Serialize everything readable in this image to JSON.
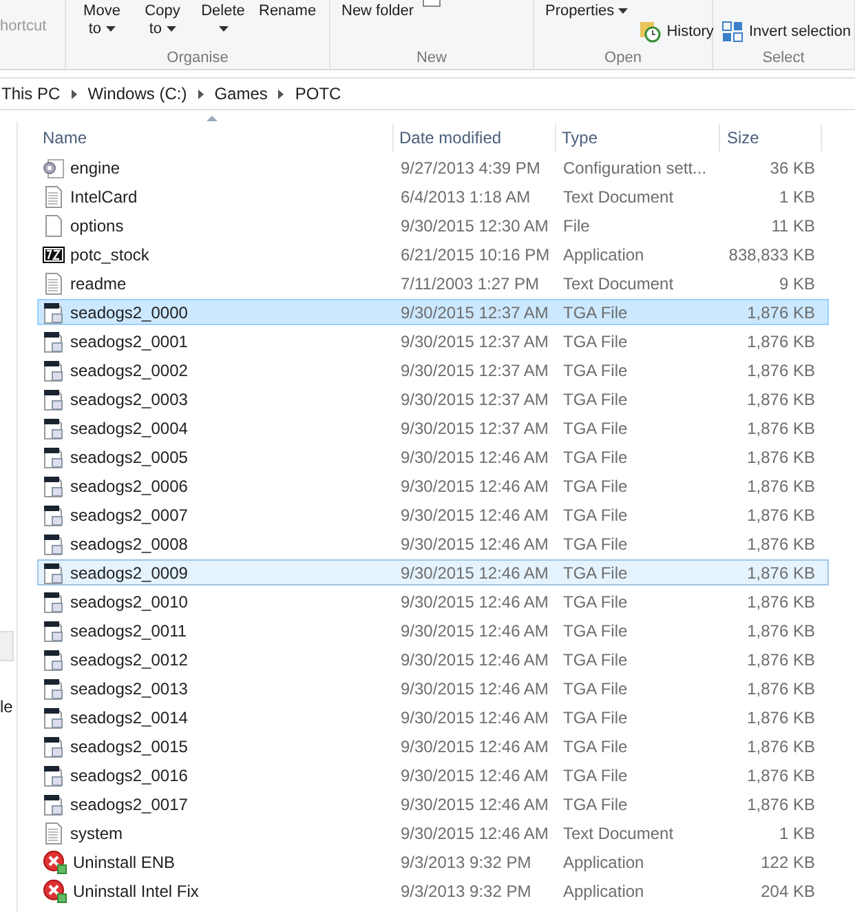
{
  "ribbon": {
    "groups": [
      {
        "buttons": [
          {
            "label": "hortcut",
            "kind": "cut-text"
          }
        ]
      },
      {
        "label": "Organise",
        "buttons": [
          {
            "label": "Move to",
            "kind": "big",
            "dropdown": true
          },
          {
            "label": "Copy to",
            "kind": "big",
            "dropdown": true
          },
          {
            "label": "Delete",
            "kind": "big",
            "dropdown": true
          },
          {
            "label": "Rename",
            "kind": "big"
          }
        ]
      },
      {
        "label": "New",
        "buttons": [
          {
            "label": "New folder",
            "kind": "big"
          },
          {
            "kind": "checkbox-cut"
          }
        ]
      },
      {
        "label": "Open",
        "buttons": [
          {
            "label": "Properties",
            "kind": "big",
            "dropdown": true
          },
          {
            "label": "History",
            "kind": "history"
          }
        ]
      },
      {
        "label": "Select",
        "buttons": [
          {
            "label": "Invert selection",
            "kind": "invert"
          }
        ]
      }
    ]
  },
  "address": [
    "This PC",
    "Windows (C:)",
    "Games",
    "POTC"
  ],
  "nav_pane": {
    "text": "le"
  },
  "table": {
    "columns": [
      {
        "label": "Name",
        "sorted": true
      },
      {
        "label": "Date modified"
      },
      {
        "label": "Type"
      },
      {
        "label": "Size"
      }
    ],
    "rows": [
      {
        "name": "engine",
        "kind": "config",
        "date": "9/27/2013 4:39 PM",
        "type": "Configuration sett...",
        "size": "36 KB",
        "selected": false,
        "hot": false
      },
      {
        "name": "IntelCard",
        "kind": "text",
        "date": "6/4/2013 1:18 AM",
        "type": "Text Document",
        "size": "1 KB",
        "selected": false,
        "hot": false
      },
      {
        "name": "options",
        "kind": "blank",
        "date": "9/30/2015 12:30 AM",
        "type": "File",
        "size": "11 KB",
        "selected": false,
        "hot": false
      },
      {
        "name": "potc_stock",
        "kind": "archive",
        "date": "6/21/2015 10:16 PM",
        "type": "Application",
        "size": "838,833 KB",
        "selected": false,
        "hot": false
      },
      {
        "name": "readme",
        "kind": "text",
        "date": "7/11/2003 1:27 PM",
        "type": "Text Document",
        "size": "9 KB",
        "selected": false,
        "hot": false
      },
      {
        "name": "seadogs2_0000",
        "kind": "tga",
        "date": "9/30/2015 12:37 AM",
        "type": "TGA File",
        "size": "1,876 KB",
        "selected": true,
        "hot": false
      },
      {
        "name": "seadogs2_0001",
        "kind": "tga",
        "date": "9/30/2015 12:37 AM",
        "type": "TGA File",
        "size": "1,876 KB",
        "selected": false,
        "hot": false
      },
      {
        "name": "seadogs2_0002",
        "kind": "tga",
        "date": "9/30/2015 12:37 AM",
        "type": "TGA File",
        "size": "1,876 KB",
        "selected": false,
        "hot": false
      },
      {
        "name": "seadogs2_0003",
        "kind": "tga",
        "date": "9/30/2015 12:37 AM",
        "type": "TGA File",
        "size": "1,876 KB",
        "selected": false,
        "hot": false
      },
      {
        "name": "seadogs2_0004",
        "kind": "tga",
        "date": "9/30/2015 12:37 AM",
        "type": "TGA File",
        "size": "1,876 KB",
        "selected": false,
        "hot": false
      },
      {
        "name": "seadogs2_0005",
        "kind": "tga",
        "date": "9/30/2015 12:46 AM",
        "type": "TGA File",
        "size": "1,876 KB",
        "selected": false,
        "hot": false
      },
      {
        "name": "seadogs2_0006",
        "kind": "tga",
        "date": "9/30/2015 12:46 AM",
        "type": "TGA File",
        "size": "1,876 KB",
        "selected": false,
        "hot": false
      },
      {
        "name": "seadogs2_0007",
        "kind": "tga",
        "date": "9/30/2015 12:46 AM",
        "type": "TGA File",
        "size": "1,876 KB",
        "selected": false,
        "hot": false
      },
      {
        "name": "seadogs2_0008",
        "kind": "tga",
        "date": "9/30/2015 12:46 AM",
        "type": "TGA File",
        "size": "1,876 KB",
        "selected": false,
        "hot": false
      },
      {
        "name": "seadogs2_0009",
        "kind": "tga",
        "date": "9/30/2015 12:46 AM",
        "type": "TGA File",
        "size": "1,876 KB",
        "selected": false,
        "hot": true
      },
      {
        "name": "seadogs2_0010",
        "kind": "tga",
        "date": "9/30/2015 12:46 AM",
        "type": "TGA File",
        "size": "1,876 KB",
        "selected": false,
        "hot": false
      },
      {
        "name": "seadogs2_0011",
        "kind": "tga",
        "date": "9/30/2015 12:46 AM",
        "type": "TGA File",
        "size": "1,876 KB",
        "selected": false,
        "hot": false
      },
      {
        "name": "seadogs2_0012",
        "kind": "tga",
        "date": "9/30/2015 12:46 AM",
        "type": "TGA File",
        "size": "1,876 KB",
        "selected": false,
        "hot": false
      },
      {
        "name": "seadogs2_0013",
        "kind": "tga",
        "date": "9/30/2015 12:46 AM",
        "type": "TGA File",
        "size": "1,876 KB",
        "selected": false,
        "hot": false
      },
      {
        "name": "seadogs2_0014",
        "kind": "tga",
        "date": "9/30/2015 12:46 AM",
        "type": "TGA File",
        "size": "1,876 KB",
        "selected": false,
        "hot": false
      },
      {
        "name": "seadogs2_0015",
        "kind": "tga",
        "date": "9/30/2015 12:46 AM",
        "type": "TGA File",
        "size": "1,876 KB",
        "selected": false,
        "hot": false
      },
      {
        "name": "seadogs2_0016",
        "kind": "tga",
        "date": "9/30/2015 12:46 AM",
        "type": "TGA File",
        "size": "1,876 KB",
        "selected": false,
        "hot": false
      },
      {
        "name": "seadogs2_0017",
        "kind": "tga",
        "date": "9/30/2015 12:46 AM",
        "type": "TGA File",
        "size": "1,876 KB",
        "selected": false,
        "hot": false
      },
      {
        "name": "system",
        "kind": "text",
        "date": "9/30/2015 12:46 AM",
        "type": "Text Document",
        "size": "1 KB",
        "selected": false,
        "hot": false
      },
      {
        "name": "Uninstall ENB",
        "kind": "uninstall",
        "date": "9/3/2013 9:32 PM",
        "type": "Application",
        "size": "122 KB",
        "selected": false,
        "hot": false
      },
      {
        "name": "Uninstall Intel Fix",
        "kind": "uninstall",
        "date": "9/3/2013 9:32 PM",
        "type": "Application",
        "size": "204 KB",
        "selected": false,
        "hot": false
      }
    ]
  }
}
